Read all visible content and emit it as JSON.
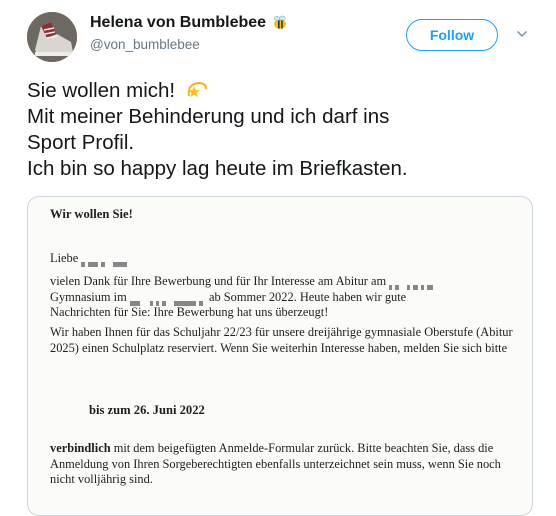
{
  "user": {
    "display_name": "Helena von Bumblebee",
    "name_emoji": "bee-emoji",
    "handle": "@von_bumblebee",
    "avatar_icon": "sneaker-avatar"
  },
  "actions": {
    "follow_label": "Follow",
    "more_icon": "chevron-down-icon"
  },
  "colors": {
    "accent": "#1da1f2",
    "handle": "#657786",
    "text": "#14171a",
    "border": "#ccd6dd"
  },
  "tweet": {
    "lines": [
      "Sie wollen mich!",
      "Mit meiner Behinderung und ich darf ins",
      "Sport Profil.",
      "Ich bin so happy lag heute im Briefkasten."
    ],
    "emoji_icon": "dizzy-star-emoji"
  },
  "letter": {
    "title": "Wir wollen Sie!",
    "salutation": "Liebe",
    "para1_a": "vielen Dank für Ihre Bewerbung und für Ihr Interesse am Abitur am",
    "para1_b_prefix": "Gymnasium im",
    "para1_b_suffix": "ab Sommer 2022. Heute haben wir gute",
    "para1_c": "Nachrichten für Sie: Ihre Bewerbung hat uns überzeugt!",
    "para2": "Wir haben Ihnen für das Schuljahr 22/23 für unsere dreijährige gymnasiale Oberstufe (Abitur 2025) einen Schulplatz reserviert. Wenn Sie weiterhin Interesse haben, melden Sie sich bitte",
    "deadline": "bis zum 26. Juni 2022",
    "para3_bold": "verbindlich",
    "para3_rest": " mit dem beigefügten Anmelde-Formular zurück. Bitte beachten Sie, dass die Anmeldung von Ihren Sorgeberechtigten ebenfalls unterzeichnet sein muss, wenn Sie noch nicht volljährig sind."
  }
}
